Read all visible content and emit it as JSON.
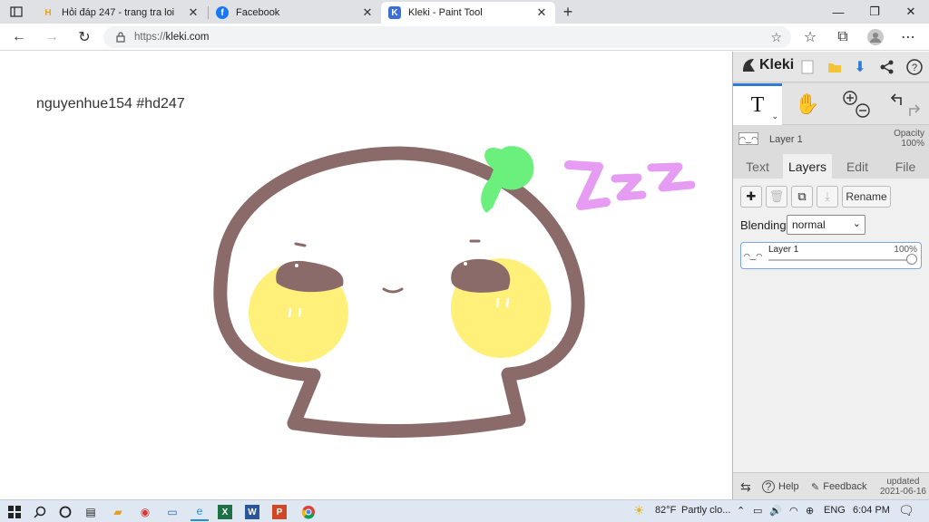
{
  "browser": {
    "tabs": [
      {
        "title": "Hỏi đáp 247 - trang tra loi",
        "favicon": "hoidap247-icon"
      },
      {
        "title": "Facebook",
        "favicon": "facebook-icon"
      },
      {
        "title": "Kleki - Paint Tool",
        "favicon": "kleki-icon",
        "active": true
      }
    ],
    "url_scheme": "https://",
    "url_host": "kleki.com"
  },
  "canvas": {
    "caption": "nguyenhue154 #hd247",
    "doodle_text": "Zzz"
  },
  "app": {
    "logo": "Kleki",
    "current_layer": "Layer 1",
    "opacity_label": "Opacity",
    "opacity_value": "100%",
    "tabs": [
      "Text",
      "Layers",
      "Edit",
      "File"
    ],
    "active_tab": "Layers",
    "rename_label": "Rename",
    "blending_label": "Blending",
    "blending_value": "normal",
    "layers": [
      {
        "name": "Layer 1",
        "opacity": "100%"
      }
    ],
    "footer": {
      "help": "Help",
      "feedback": "Feedback",
      "updated_label": "updated",
      "updated_date": "2021-06-16"
    }
  },
  "taskbar": {
    "weather_temp": "82°F",
    "weather_desc": "Partly clo...",
    "lang": "ENG",
    "time": "6:04 PM"
  },
  "colors": {
    "accent": "#2d7bd3",
    "outline": "#8a6b69",
    "cheek": "#fff07a",
    "leaf": "#6cf07d",
    "zzz": "#e59cf2"
  }
}
